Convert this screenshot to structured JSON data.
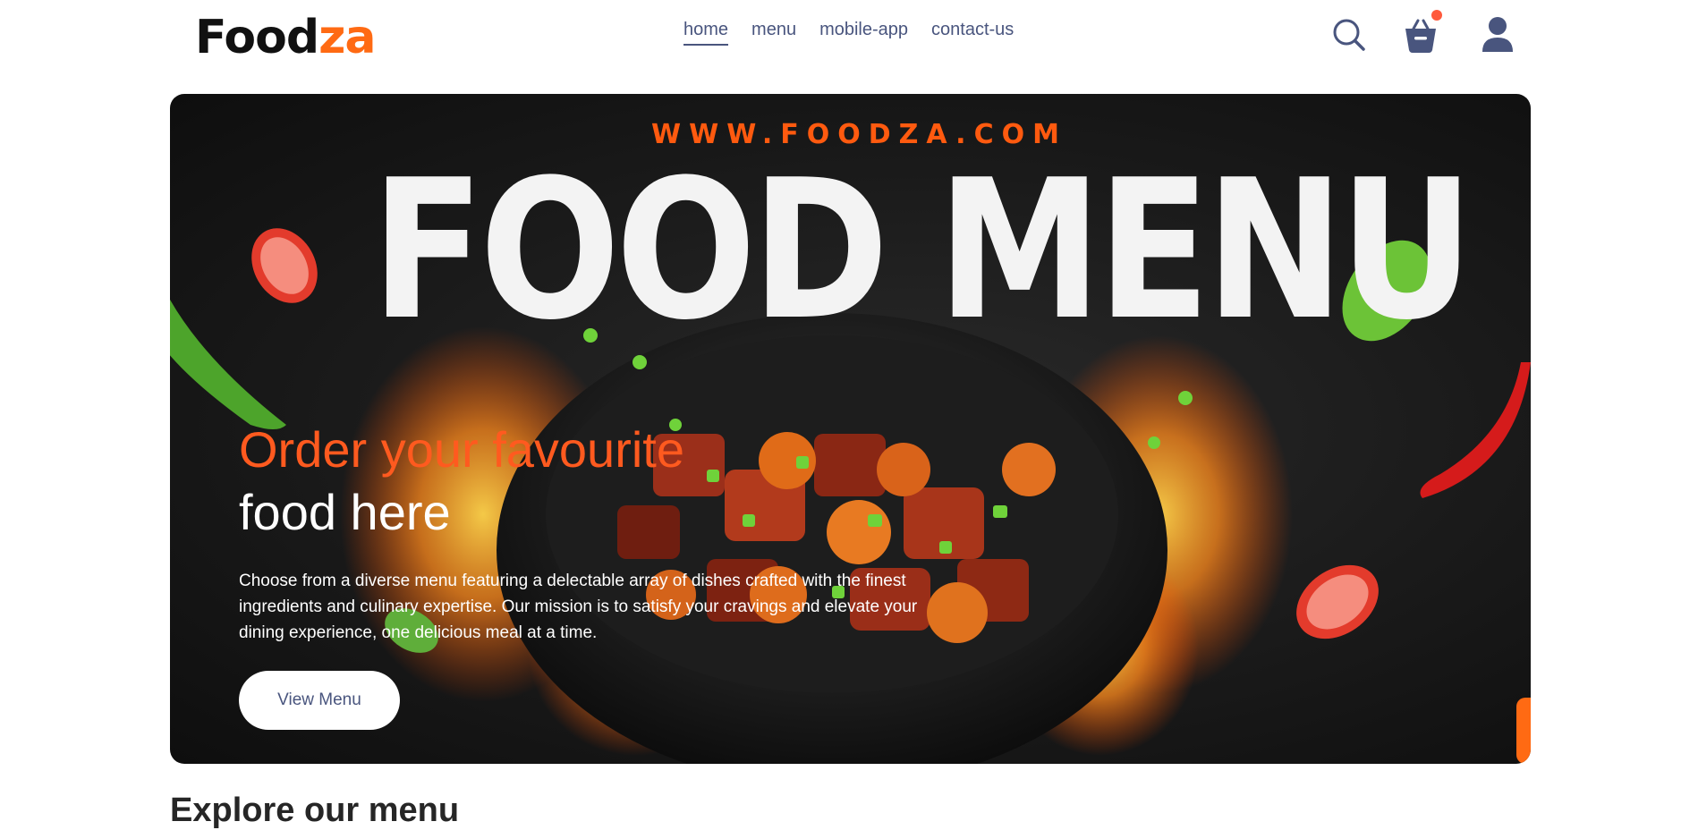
{
  "brand": {
    "logo_main": "Food",
    "logo_accent": "za",
    "accent_color": "#ff6a13"
  },
  "nav": {
    "items": [
      {
        "label": "home",
        "active": true
      },
      {
        "label": "menu",
        "active": false
      },
      {
        "label": "mobile-app",
        "active": false
      },
      {
        "label": "contact-us",
        "active": false
      }
    ],
    "icons": [
      "search-icon",
      "basket-icon",
      "profile-icon"
    ],
    "cart_has_items": true
  },
  "hero": {
    "banner_url_text": "WWW.FOODZA.COM",
    "banner_title": "FOOD MENU",
    "headline_line1": "Order your favourite",
    "headline_line2": "food here",
    "description": "Choose from a diverse menu featuring a delectable array of dishes crafted with the finest ingredients and culinary expertise. Our mission is to satisfy your cravings and elevate your dining experience, one delicious meal at a time.",
    "cta_label": "View Menu"
  },
  "section": {
    "title": "Explore our menu"
  }
}
